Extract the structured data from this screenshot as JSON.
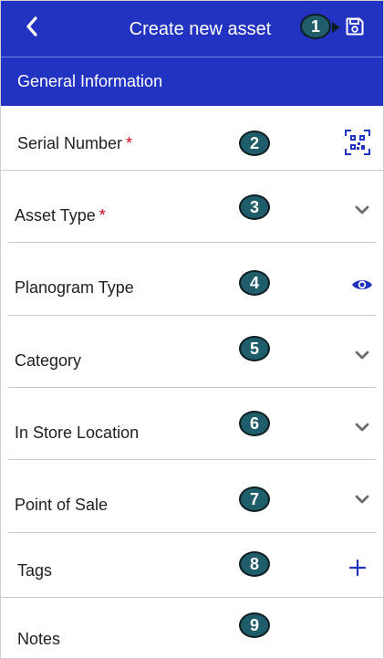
{
  "header": {
    "title": "Create new asset",
    "back_icon": "chevron-left-icon",
    "save_icon": "floppy-disk-icon",
    "background": "#2133c0"
  },
  "section": {
    "title": "General Information"
  },
  "required_marker": "*",
  "badges": [
    "1",
    "2",
    "3",
    "4",
    "5",
    "6",
    "7",
    "8",
    "9"
  ],
  "fields": [
    {
      "label": "Serial Number",
      "required": true,
      "icon": "qr-code-icon"
    },
    {
      "label": "Asset Type",
      "required": true,
      "icon": "chevron-down-icon"
    },
    {
      "label": "Planogram Type",
      "required": false,
      "icon": "eye-icon"
    },
    {
      "label": "Category",
      "required": false,
      "icon": "chevron-down-icon"
    },
    {
      "label": "In Store Location",
      "required": false,
      "icon": "chevron-down-icon"
    },
    {
      "label": "Point of Sale",
      "required": false,
      "icon": "chevron-down-icon"
    },
    {
      "label": "Tags",
      "required": false,
      "icon": "plus-icon"
    },
    {
      "label": "Notes",
      "required": false,
      "icon": ""
    }
  ],
  "colors": {
    "primary": "#2133c0",
    "required": "#d0021b",
    "badge": "#1f5d6a",
    "chevron": "#6d6d6d"
  }
}
